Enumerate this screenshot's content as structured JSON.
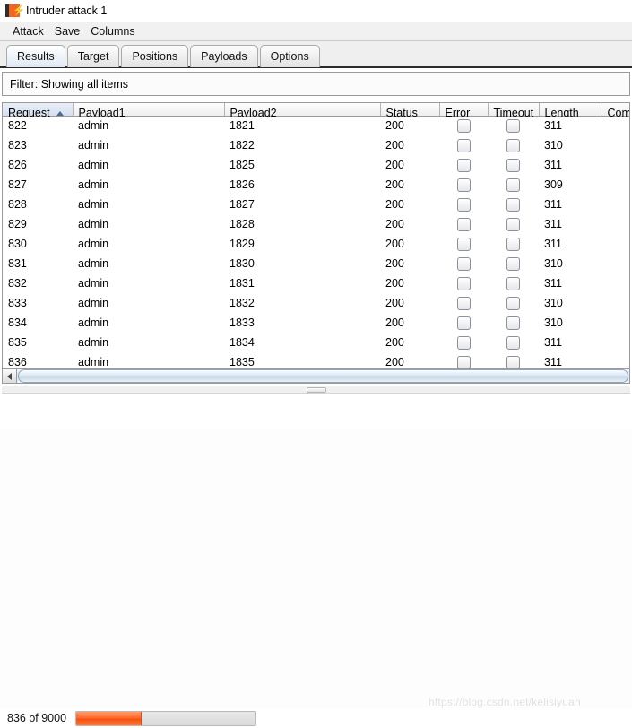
{
  "window": {
    "title": "Intruder attack 1",
    "icon": "burp-suite-icon"
  },
  "menu": {
    "items": [
      {
        "label": "Attack"
      },
      {
        "label": "Save"
      },
      {
        "label": "Columns"
      }
    ]
  },
  "tabs": [
    {
      "label": "Results",
      "active": true
    },
    {
      "label": "Target",
      "active": false
    },
    {
      "label": "Positions",
      "active": false
    },
    {
      "label": "Payloads",
      "active": false
    },
    {
      "label": "Options",
      "active": false
    }
  ],
  "filter": {
    "label": "Filter: Showing all items"
  },
  "table": {
    "columns": [
      {
        "key": "request",
        "label": "Request",
        "sorted": true,
        "sort_direction": "asc"
      },
      {
        "key": "payload1",
        "label": "Payload1",
        "sorted": false
      },
      {
        "key": "payload2",
        "label": "Payload2",
        "sorted": false
      },
      {
        "key": "status",
        "label": "Status",
        "sorted": false
      },
      {
        "key": "error",
        "label": "Error",
        "sorted": false
      },
      {
        "key": "timeout",
        "label": "Timeout",
        "sorted": false
      },
      {
        "key": "length",
        "label": "Length",
        "sorted": false
      },
      {
        "key": "comment",
        "label": "Com",
        "sorted": false
      }
    ],
    "rows": [
      {
        "request": "822",
        "payload1": "admin",
        "payload2": "1821",
        "status": "200",
        "error": false,
        "timeout": false,
        "length": "311",
        "comment": ""
      },
      {
        "request": "823",
        "payload1": "admin",
        "payload2": "1822",
        "status": "200",
        "error": false,
        "timeout": false,
        "length": "310",
        "comment": ""
      },
      {
        "request": "826",
        "payload1": "admin",
        "payload2": "1825",
        "status": "200",
        "error": false,
        "timeout": false,
        "length": "311",
        "comment": ""
      },
      {
        "request": "827",
        "payload1": "admin",
        "payload2": "1826",
        "status": "200",
        "error": false,
        "timeout": false,
        "length": "309",
        "comment": ""
      },
      {
        "request": "828",
        "payload1": "admin",
        "payload2": "1827",
        "status": "200",
        "error": false,
        "timeout": false,
        "length": "311",
        "comment": ""
      },
      {
        "request": "829",
        "payload1": "admin",
        "payload2": "1828",
        "status": "200",
        "error": false,
        "timeout": false,
        "length": "311",
        "comment": ""
      },
      {
        "request": "830",
        "payload1": "admin",
        "payload2": "1829",
        "status": "200",
        "error": false,
        "timeout": false,
        "length": "311",
        "comment": ""
      },
      {
        "request": "831",
        "payload1": "admin",
        "payload2": "1830",
        "status": "200",
        "error": false,
        "timeout": false,
        "length": "310",
        "comment": ""
      },
      {
        "request": "832",
        "payload1": "admin",
        "payload2": "1831",
        "status": "200",
        "error": false,
        "timeout": false,
        "length": "311",
        "comment": ""
      },
      {
        "request": "833",
        "payload1": "admin",
        "payload2": "1832",
        "status": "200",
        "error": false,
        "timeout": false,
        "length": "310",
        "comment": ""
      },
      {
        "request": "834",
        "payload1": "admin",
        "payload2": "1833",
        "status": "200",
        "error": false,
        "timeout": false,
        "length": "310",
        "comment": ""
      },
      {
        "request": "835",
        "payload1": "admin",
        "payload2": "1834",
        "status": "200",
        "error": false,
        "timeout": false,
        "length": "311",
        "comment": ""
      },
      {
        "request": "836",
        "payload1": "admin",
        "payload2": "1835",
        "status": "200",
        "error": false,
        "timeout": false,
        "length": "311",
        "comment": ""
      }
    ]
  },
  "status": {
    "progress_label": "836 of 9000",
    "completed": 836,
    "total": 9000,
    "progress_percent": 36,
    "progress_color": "#f4500e"
  },
  "watermark": {
    "text": "https://blog.csdn.net/kelisiyuan"
  }
}
